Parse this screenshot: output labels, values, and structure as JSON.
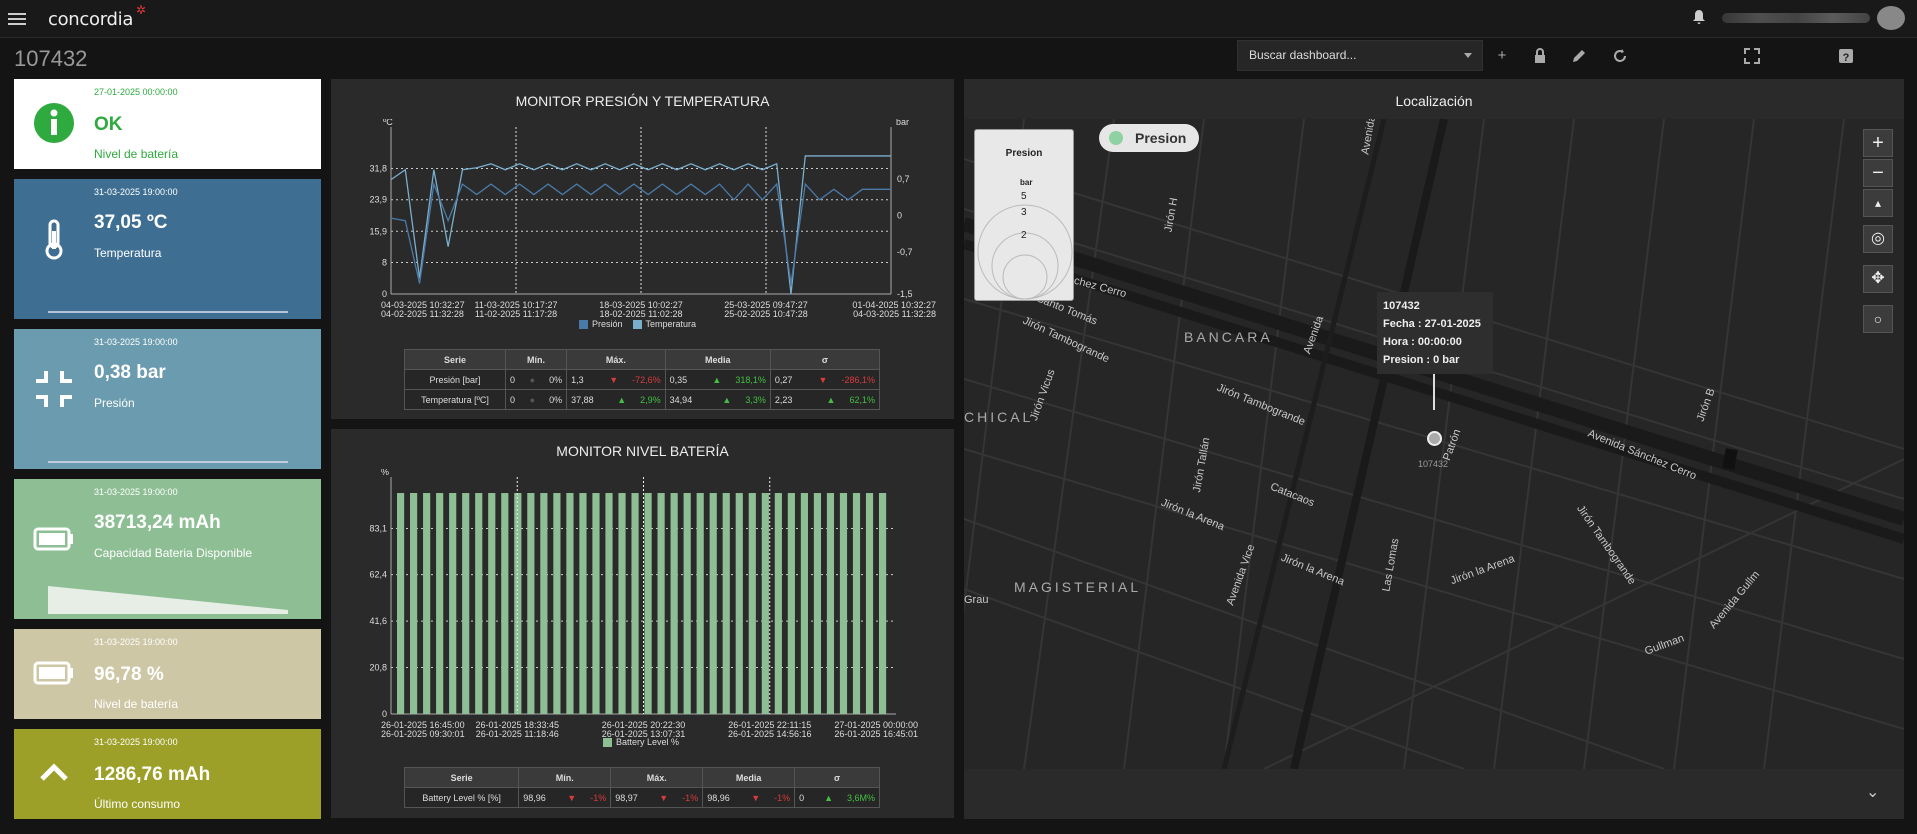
{
  "header": {
    "logo": "concordia",
    "page_title": "107432",
    "search_placeholder": "Buscar dashboard..."
  },
  "cards": [
    {
      "date": "27-01-2025 00:00:00",
      "value": "OK",
      "label": "Nivel de batería",
      "bg": "#ffffff",
      "color": "#2eaa3e",
      "icon": "info-icon"
    },
    {
      "date": "31-03-2025 19:00:00",
      "value": "37,05 ºC",
      "label": "Temperatura",
      "bg": "#3e6f93",
      "color": "#ffffff",
      "icon": "thermometer-icon"
    },
    {
      "date": "31-03-2025 19:00:00",
      "value": "0,38 bar",
      "label": "Presión",
      "bg": "#6b9bae",
      "color": "#ffffff",
      "icon": "compress-icon"
    },
    {
      "date": "31-03-2025 19:00:00",
      "value": "38713,24 mAh",
      "label": "Capacidad Bateria Disponible",
      "bg": "#8ebf94",
      "color": "#ffffff",
      "icon": "battery-icon",
      "trend": [
        1.0,
        0.0
      ]
    },
    {
      "date": "31-03-2025 19:00:00",
      "value": "96,78 %",
      "label": "Nivel de batería",
      "bg": "#cdc7a6",
      "color": "#ffffff",
      "icon": "battery-icon"
    },
    {
      "date": "31-03-2025 19:00:00",
      "value": "1286,76 mAh",
      "label": "Último consumo",
      "bg": "#9c9f28",
      "color": "#ffffff",
      "icon": "chevron-up-icon"
    }
  ],
  "chart_data": [
    {
      "type": "line",
      "title": "MONITOR PRESIÓN Y TEMPERATURA",
      "ylabel": "ºC",
      "y2label": "bar",
      "yticks": [
        "31,8",
        "23,9",
        "15,9",
        "8",
        "0"
      ],
      "y2ticks": [
        "0,7",
        "0",
        "-0,7",
        "-1,5"
      ],
      "ylim": [
        0,
        39.8
      ],
      "y2lim": [
        -1.5,
        1.5
      ],
      "xticks": [
        [
          "04-03-2025 10:32:27",
          "04-02-2025 11:32:28"
        ],
        [
          "11-03-2025 10:17:27",
          "11-02-2025 11:17:28"
        ],
        [
          "18-03-2025 10:02:27",
          "18-02-2025 11:02:28"
        ],
        [
          "25-03-2025 09:47:27",
          "25-02-2025 10:47:28"
        ],
        [
          "01-04-2025 10:32:27",
          "04-03-2025 11:32:28"
        ]
      ],
      "series": [
        {
          "name": "Presión",
          "color": "#4a7aa8",
          "values": [
            -0.05,
            -0.1,
            -1.3,
            0.6,
            -0.1,
            0.6,
            0.4,
            0.6,
            0.4,
            0.6,
            0.4,
            0.6,
            0.4,
            0.6,
            0.4,
            0.6,
            0.4,
            0.6,
            0.4,
            0.6,
            0.4,
            0.6,
            0.4,
            0.6,
            0.3,
            0.6,
            0.3,
            0.6,
            -1.3,
            0.6,
            0.3,
            0.5,
            0.3,
            0.5,
            0.5,
            0.5
          ]
        },
        {
          "name": "Temperatura",
          "color": "#7aaecd",
          "values": [
            29,
            31.5,
            4,
            31.5,
            12,
            31.5,
            32,
            33,
            31.5,
            33,
            31.5,
            33,
            31.5,
            33,
            31.5,
            33,
            31.5,
            33,
            31.5,
            33,
            31.5,
            33,
            31.5,
            33,
            31.5,
            33,
            31.5,
            33,
            0,
            35,
            35,
            35,
            35,
            35,
            35,
            35
          ]
        }
      ],
      "table": {
        "headers": [
          "Serie",
          "Mín.",
          "Máx.",
          "Media",
          "σ"
        ],
        "rows": [
          {
            "name": "Presión [bar]",
            "min": "0",
            "min_pct": "0%",
            "max": "1,3",
            "max_dir": "down",
            "max_pct": "-72,6%",
            "mean": "0,35",
            "mean_dir": "up",
            "mean_pct": "318,1%",
            "sd": "0,27",
            "sd_dir": "down",
            "sd_pct": "-286,1%"
          },
          {
            "name": "Temperatura [ºC]",
            "min": "0",
            "min_pct": "0%",
            "max": "37,88",
            "max_dir": "up",
            "max_pct": "2,9%",
            "mean": "34,94",
            "mean_dir": "up",
            "mean_pct": "3,3%",
            "sd": "2,23",
            "sd_dir": "up",
            "sd_pct": "62,1%"
          }
        ]
      }
    },
    {
      "type": "bar",
      "title": "MONITOR NIVEL BATERÍA",
      "ylabel": "%",
      "yticks": [
        "83,1",
        "62,4",
        "41,6",
        "20,8",
        "0"
      ],
      "ylim": [
        0,
        103.9
      ],
      "xticks": [
        [
          "26-01-2025 16:45:00",
          "26-01-2025 09:30:01"
        ],
        [
          "26-01-2025 18:33:45",
          "26-01-2025 11:18:46"
        ],
        [
          "26-01-2025 20:22:30",
          "26-01-2025 13:07:31"
        ],
        [
          "26-01-2025 22:11:15",
          "26-01-2025 14:56:16"
        ],
        [
          "27-01-2025 00:00:00",
          "26-01-2025 16:45:01"
        ]
      ],
      "series": [
        {
          "name": "Battery Level %",
          "color": "#8ebf94",
          "values": [
            98.96,
            98.97,
            98.96,
            98.96,
            98.97,
            98.96,
            98.96,
            98.97,
            98.96,
            98.96,
            98.97,
            98.96,
            98.96,
            98.97,
            98.96,
            98.96,
            98.97,
            98.96,
            98.96,
            98.97,
            98.96,
            98.96,
            98.97,
            98.96,
            98.96,
            98.97,
            98.96,
            98.96,
            98.97,
            98.96,
            98.96,
            98.97,
            98.96,
            98.96,
            98.97,
            98.96,
            98.96,
            98.97
          ]
        }
      ],
      "table": {
        "headers": [
          "Serie",
          "Mín.",
          "Máx.",
          "Media",
          "σ"
        ],
        "rows": [
          {
            "name": "Battery Level % [%]",
            "min": "98,96",
            "min_dir": "down",
            "min_pct": "-1%",
            "max": "98,97",
            "max_dir": "down",
            "max_pct": "-1%",
            "mean": "98,96",
            "mean_dir": "down",
            "mean_pct": "-1%",
            "sd": "0",
            "sd_dir": "up",
            "sd_pct": "3,6M%"
          }
        ]
      }
    }
  ],
  "map": {
    "title": "Localización",
    "layer_label": "Presion",
    "legend": {
      "title": "Presion",
      "unit": "bar",
      "values": [
        "5",
        "3",
        "2"
      ]
    },
    "popup": {
      "id": "107432",
      "fecha": "Fecha : 27-01-2025",
      "hora": "Hora : 00:00:00",
      "presion": "Presion : 0 bar"
    },
    "marker_label": "107432",
    "labels": [
      "Sánchez Cerro",
      "Jirón Santo Tomás",
      "Jirón Tambogrande",
      "Jirón Vicus",
      "BANCARA",
      "Jirón H",
      "Avenida",
      "Avenida",
      "Jirón Tambogrande",
      "CHICAL",
      "Jirón Tallán",
      "Patrón",
      "Avenida Sánchez Cerro",
      "Jirón B",
      "Catacaos",
      "Jirón la Arena",
      "Las Lomas",
      "Jirón la Arena",
      "Jirón la Arena",
      "Jirón Tambogrande",
      "MAGISTERIAL",
      "Avenida Vice",
      "Grau",
      "Gullman",
      "Avenida Gullm"
    ]
  }
}
